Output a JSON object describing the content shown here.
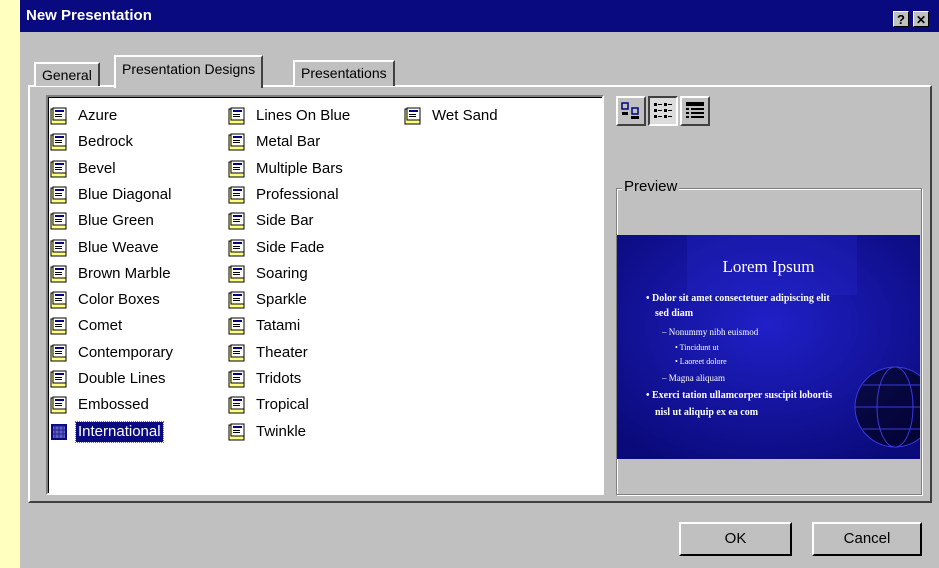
{
  "window": {
    "title": "New Presentation",
    "help_glyph": "?",
    "close_glyph": "✕"
  },
  "tabs": [
    {
      "label": "General",
      "active": false
    },
    {
      "label": "Presentation Designs",
      "active": true
    },
    {
      "label": "Presentations",
      "active": false
    }
  ],
  "designs": {
    "columns": [
      [
        "Azure",
        "Bedrock",
        "Bevel",
        "Blue Diagonal",
        "Blue Green",
        "Blue Weave",
        "Brown Marble",
        "Color Boxes",
        "Comet",
        "Contemporary",
        "Double Lines",
        "Embossed",
        "International"
      ],
      [
        "Lines On Blue",
        "Metal Bar",
        "Multiple Bars",
        "Professional",
        "Side Bar",
        "Side Fade",
        "Soaring",
        "Sparkle",
        "Tatami",
        "Theater",
        "Tridots",
        "Tropical",
        "Twinkle"
      ],
      [
        "Wet Sand"
      ]
    ],
    "selected": "International",
    "icon": "template-file-icon"
  },
  "view_buttons": [
    {
      "name": "large-icons-view",
      "icon": "large-icons-icon",
      "pressed": false
    },
    {
      "name": "list-view",
      "icon": "list-icon",
      "pressed": true
    },
    {
      "name": "details-view",
      "icon": "details-icon",
      "pressed": false
    }
  ],
  "preview": {
    "group_label": "Preview",
    "slide_title": "Lorem Ipsum",
    "bullets": [
      "• Dolor sit amet consectetuer adipiscing elit",
      "sed diam",
      "– Nonummy nibh euismod",
      "• Tincidunt ut",
      "• Laoreet dolore",
      "– Magna aliquam",
      "• Exerci tation ullamcorper suscipit lobortis",
      "nisl ut aliquip ex ea com"
    ],
    "background_color": "#0f0f9a"
  },
  "buttons": {
    "ok": "OK",
    "cancel": "Cancel"
  },
  "colors": {
    "titlebar": "#0a0a80",
    "dialog_face": "#c0c0c0",
    "selection": "#0a0a80",
    "desktop": "#ffffc0"
  }
}
